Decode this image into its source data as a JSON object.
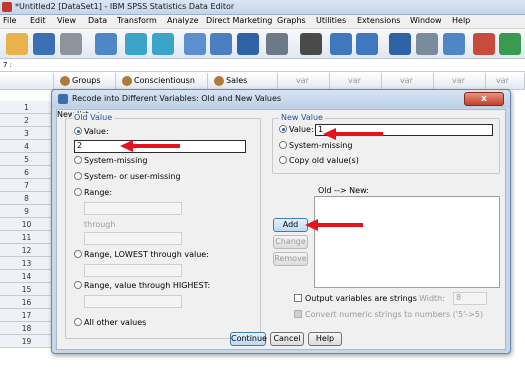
{
  "window": {
    "title": "*Untitled2 [DataSet1] - IBM SPSS Statistics Data Editor"
  },
  "menu": [
    "File",
    "Edit",
    "View",
    "Data",
    "Transform",
    "Analyze",
    "Direct Marketing",
    "Graphs",
    "Utilities",
    "Extensions",
    "Window",
    "Help"
  ],
  "cell_ref": "7 :",
  "columns": [
    "Groups",
    "Conscientiousn",
    "Sales"
  ],
  "extra_col_label": "var",
  "rows": [
    "1",
    "2",
    "3",
    "4",
    "5",
    "6",
    "7",
    "8",
    "9",
    "10",
    "11",
    "12",
    "13",
    "14",
    "15",
    "16",
    "17",
    "18",
    "19"
  ],
  "dialog": {
    "title": "Recode into Different Variables: Old and New Values",
    "close_label": "x",
    "old_value": {
      "group_label": "Old Value",
      "value_label": "Value:",
      "value_input": "2",
      "system_missing": "System-missing",
      "system_or_user_missing": "System- or user-missing",
      "range": "Range:",
      "through": "through",
      "range_lowest": "Range, LOWEST through value:",
      "range_highest": "Range, value through HIGHEST:",
      "all_other": "All other values"
    },
    "new_value": {
      "group_label": "New Value",
      "value_label": "Value:",
      "value_input": "1",
      "system_missing": "System-missing",
      "copy_old": "Copy old value(s)"
    },
    "list_label": "Old --> New:",
    "add": "Add",
    "change": "Change",
    "remove": "Remove",
    "output_strings": "Output variables are strings",
    "width_label": "Width:",
    "width_value": "8",
    "convert_numeric": "Convert numeric strings to numbers ('5'->5)",
    "continue": "Continue",
    "cancel": "Cancel",
    "help": "Help"
  },
  "colors": {
    "annotation_arrow": "#e3141c",
    "dialog_frame": "#c6d7ea"
  }
}
